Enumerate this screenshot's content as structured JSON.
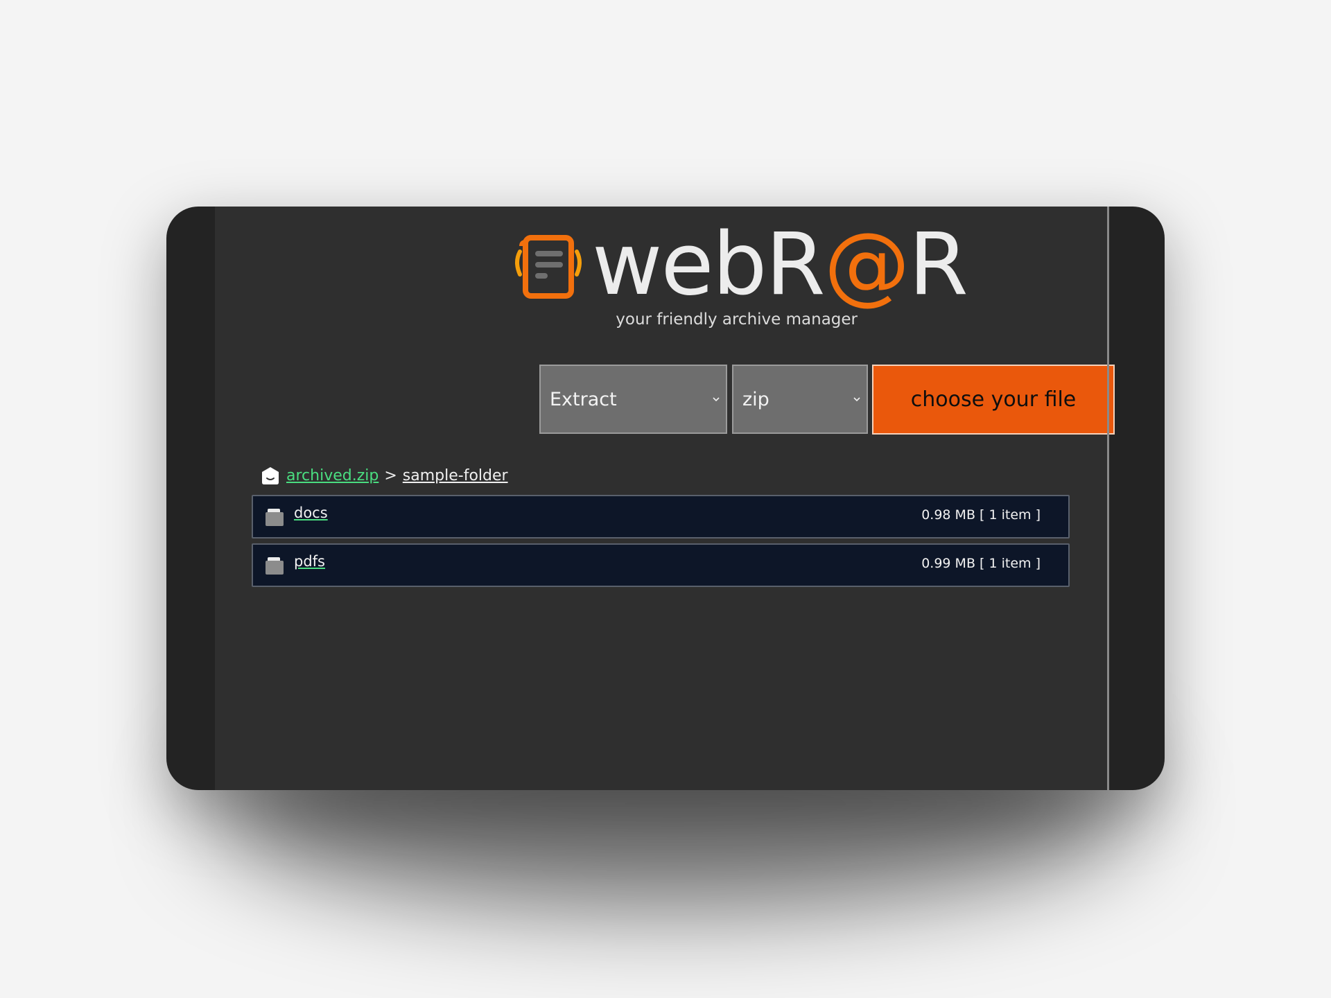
{
  "app": {
    "logo_text_pre": "webR",
    "logo_text_at": "@",
    "logo_text_post": "R",
    "tagline": "your friendly archive manager",
    "accent_color": "#ea580c",
    "link_color": "#4ade80"
  },
  "controls": {
    "mode_select": {
      "value": "Extract",
      "icon": "chevron-down-icon"
    },
    "format_select": {
      "value": "zip",
      "icon": "chevron-down-icon"
    },
    "choose_button_label": "choose your file"
  },
  "breadcrumb": {
    "home_icon": "home-icon",
    "root": "archived.zip",
    "separator": ">",
    "current": "sample-folder"
  },
  "files": [
    {
      "name": "docs",
      "size": "0.98 MB",
      "items": "[ 1 item ]",
      "icon": "folder-icon"
    },
    {
      "name": "pdfs",
      "size": "0.99 MB",
      "items": "[ 1 item ]",
      "icon": "folder-icon"
    }
  ]
}
